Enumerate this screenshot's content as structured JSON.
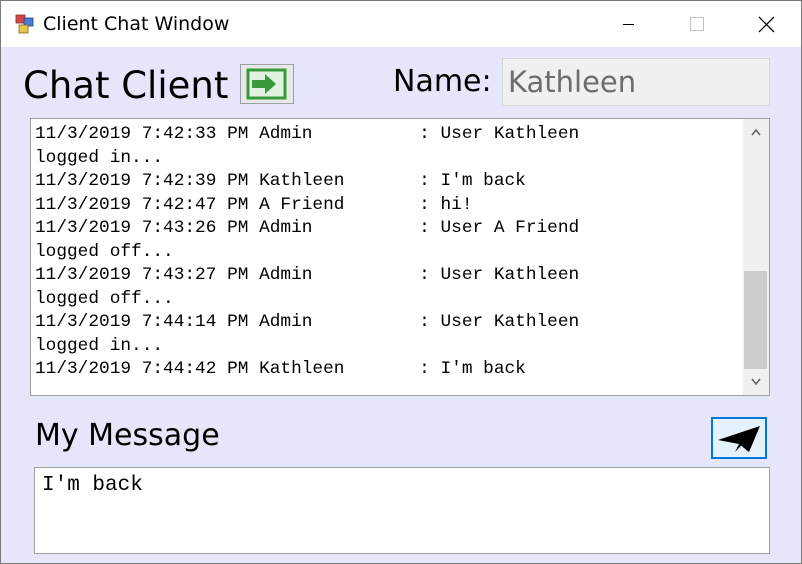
{
  "window": {
    "title": "Client Chat Window",
    "icons": {
      "app": "app-icon",
      "minimize": "minimize-icon",
      "maximize": "maximize-icon",
      "close": "close-icon"
    }
  },
  "header": {
    "title": "Chat Client",
    "login_icon": "login-icon",
    "name_label": "Name:",
    "name_value": "Kathleen"
  },
  "chat_log": {
    "lines": [
      "11/3/2019 7:42:33 PM Admin          : User Kathleen",
      "logged in...",
      "11/3/2019 7:42:39 PM Kathleen       : I'm back",
      "11/3/2019 7:42:47 PM A Friend       : hi!",
      "11/3/2019 7:43:26 PM Admin          : User A Friend",
      "logged off...",
      "11/3/2019 7:43:27 PM Admin          : User Kathleen",
      "logged off...",
      "11/3/2019 7:44:14 PM Admin          : User Kathleen",
      "logged in...",
      "11/3/2019 7:44:42 PM Kathleen       : I'm back"
    ]
  },
  "message": {
    "label": "My Message",
    "value": "I'm back",
    "send_icon": "send-icon"
  },
  "colors": {
    "window_background": "#e6e6fa",
    "login_icon_green": "#3a9a3a",
    "send_button_border": "#0078d7"
  }
}
